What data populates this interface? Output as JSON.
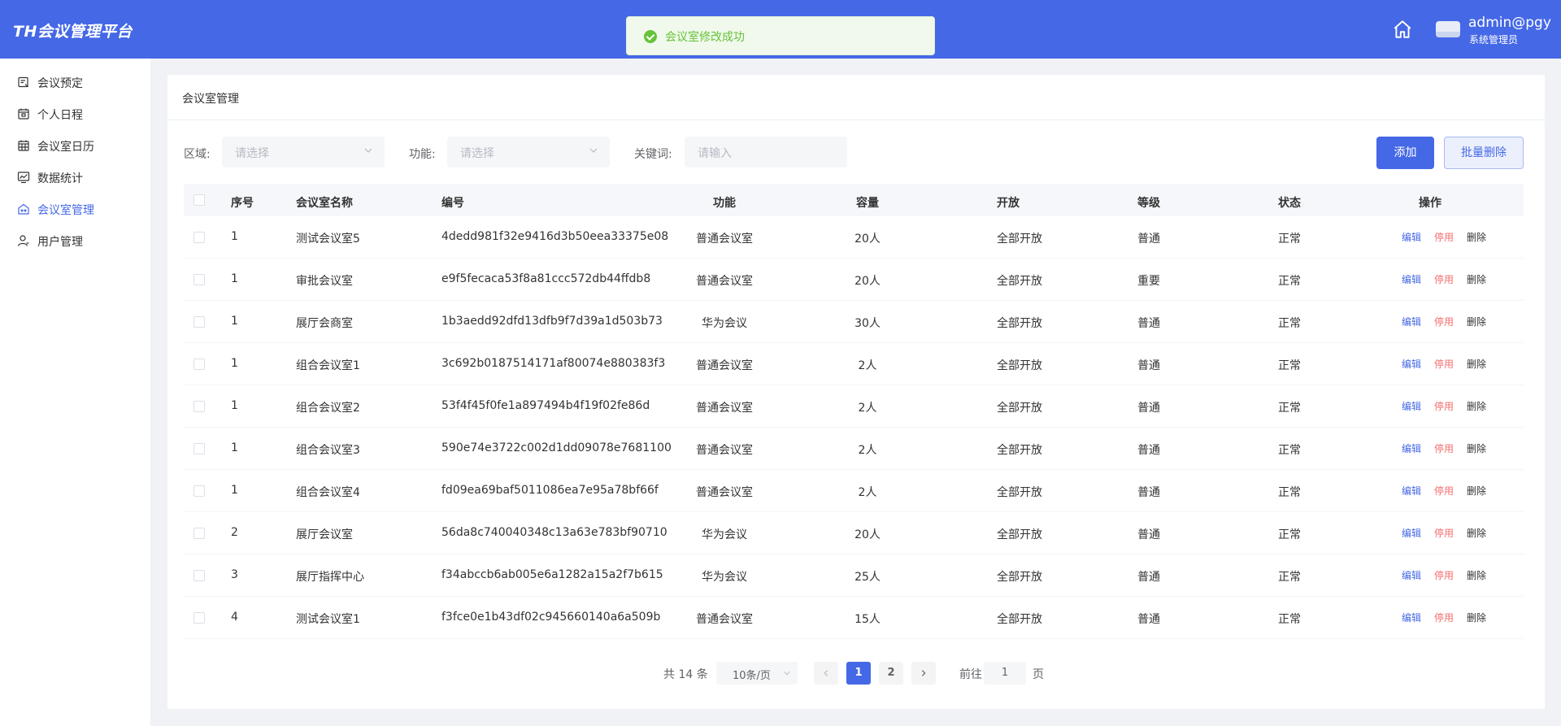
{
  "app": {
    "title": "TH会议管理平台"
  },
  "header": {
    "user_name": "admin@pgy",
    "user_role": "系统管理员"
  },
  "toast": {
    "message": "会议室修改成功"
  },
  "sidebar": {
    "items": [
      {
        "label": "会议预定",
        "icon": "calendar-edit-icon"
      },
      {
        "label": "个人日程",
        "icon": "calendar-icon"
      },
      {
        "label": "会议室日历",
        "icon": "calendar-grid-icon"
      },
      {
        "label": "数据统计",
        "icon": "chart-icon"
      },
      {
        "label": "会议室管理",
        "icon": "meeting-room-icon",
        "active": true
      },
      {
        "label": "用户管理",
        "icon": "user-icon"
      }
    ]
  },
  "page": {
    "title": "会议室管理"
  },
  "filters": {
    "region_label": "区域:",
    "region_placeholder": "请选择",
    "function_label": "功能:",
    "function_placeholder": "请选择",
    "keyword_label": "关键词:",
    "keyword_placeholder": "请输入"
  },
  "buttons": {
    "add": "添加",
    "batch_delete": "批量删除"
  },
  "table": {
    "columns": [
      "序号",
      "会议室名称",
      "编号",
      "功能",
      "容量",
      "开放",
      "等级",
      "状态",
      "操作"
    ],
    "actions": {
      "edit": "编辑",
      "disable": "停用",
      "delete": "删除"
    },
    "rows": [
      {
        "seq": "1",
        "name": "测试会议室5",
        "code": "4dedd981f32e9416d3b50eea33375e08",
        "func": "普通会议室",
        "capacity": "20人",
        "open": "全部开放",
        "level": "普通",
        "status": "正常"
      },
      {
        "seq": "1",
        "name": "审批会议室",
        "code": "e9f5fecaca53f8a81ccc572db44ffdb8",
        "func": "普通会议室",
        "capacity": "20人",
        "open": "全部开放",
        "level": "重要",
        "status": "正常"
      },
      {
        "seq": "1",
        "name": "展厅会商室",
        "code": "1b3aedd92dfd13dfb9f7d39a1d503b73",
        "func": "华为会议",
        "capacity": "30人",
        "open": "全部开放",
        "level": "普通",
        "status": "正常"
      },
      {
        "seq": "1",
        "name": "组合会议室1",
        "code": "3c692b0187514171af80074e880383f3",
        "func": "普通会议室",
        "capacity": "2人",
        "open": "全部开放",
        "level": "普通",
        "status": "正常"
      },
      {
        "seq": "1",
        "name": "组合会议室2",
        "code": "53f4f45f0fe1a897494b4f19f02fe86d",
        "func": "普通会议室",
        "capacity": "2人",
        "open": "全部开放",
        "level": "普通",
        "status": "正常"
      },
      {
        "seq": "1",
        "name": "组合会议室3",
        "code": "590e74e3722c002d1dd09078e7681100",
        "func": "普通会议室",
        "capacity": "2人",
        "open": "全部开放",
        "level": "普通",
        "status": "正常"
      },
      {
        "seq": "1",
        "name": "组合会议室4",
        "code": "fd09ea69baf5011086ea7e95a78bf66f",
        "func": "普通会议室",
        "capacity": "2人",
        "open": "全部开放",
        "level": "普通",
        "status": "正常"
      },
      {
        "seq": "2",
        "name": "展厅会议室",
        "code": "56da8c740040348c13a63e783bf90710",
        "func": "华为会议",
        "capacity": "20人",
        "open": "全部开放",
        "level": "普通",
        "status": "正常"
      },
      {
        "seq": "3",
        "name": "展厅指挥中心",
        "code": "f34abccb6ab005e6a1282a15a2f7b615",
        "func": "华为会议",
        "capacity": "25人",
        "open": "全部开放",
        "level": "普通",
        "status": "正常"
      },
      {
        "seq": "4",
        "name": "测试会议室1",
        "code": "f3fce0e1b43df02c945660140a6a509b",
        "func": "普通会议室",
        "capacity": "15人",
        "open": "全部开放",
        "level": "普通",
        "status": "正常"
      }
    ]
  },
  "pagination": {
    "total": "共 14 条",
    "page_size": "10条/页",
    "pages": [
      "1",
      "2"
    ],
    "current": "1",
    "goto_label": "前往",
    "goto_value": "1",
    "page_suffix": "页"
  }
}
